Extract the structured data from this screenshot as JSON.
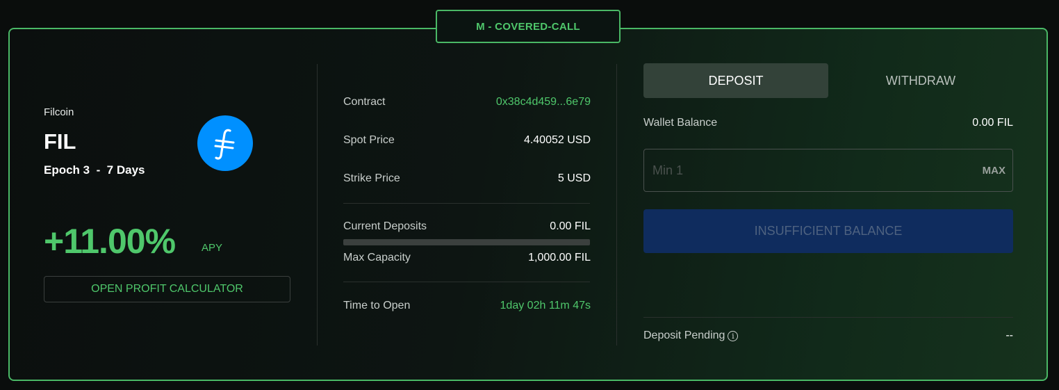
{
  "vault": {
    "tag": "M - COVERED-CALL"
  },
  "asset": {
    "name": "Filcoin",
    "symbol": "FIL",
    "epoch": "Epoch 3  -  7 Days",
    "logo_icon": "filecoin-icon",
    "logo_color": "#0090ff"
  },
  "apy": {
    "value": "+11.00%",
    "label": "APY"
  },
  "calculator": {
    "label": "OPEN PROFIT CALCULATOR"
  },
  "details": {
    "contract": {
      "label": "Contract",
      "value": "0x38c4d459...6e79"
    },
    "spot_price": {
      "label": "Spot Price",
      "value": "4.40052 USD"
    },
    "strike_price": {
      "label": "Strike Price",
      "value": "5 USD"
    },
    "current_deposits": {
      "label": "Current Deposits",
      "value": "0.00 FIL"
    },
    "capacity_fill_fraction": 0,
    "max_capacity": {
      "label": "Max Capacity",
      "value": "1,000.00 FIL"
    },
    "time_to_open": {
      "label": "Time to Open",
      "value": "1day 02h 11m 47s"
    }
  },
  "actions": {
    "tabs": [
      {
        "label": "DEPOSIT",
        "active": true
      },
      {
        "label": "WITHDRAW",
        "active": false
      }
    ],
    "wallet_balance": {
      "label": "Wallet Balance",
      "value": "0.00 FIL"
    },
    "amount_input": {
      "placeholder": "Min 1",
      "value": ""
    },
    "max_label": "MAX",
    "submit_label": "INSUFFICIENT BALANCE",
    "deposit_pending": {
      "label": "Deposit Pending",
      "value": "--"
    }
  },
  "colors": {
    "accent": "#4fc76b",
    "border": "#4ab866",
    "button_disabled": "#0f2c5e"
  }
}
